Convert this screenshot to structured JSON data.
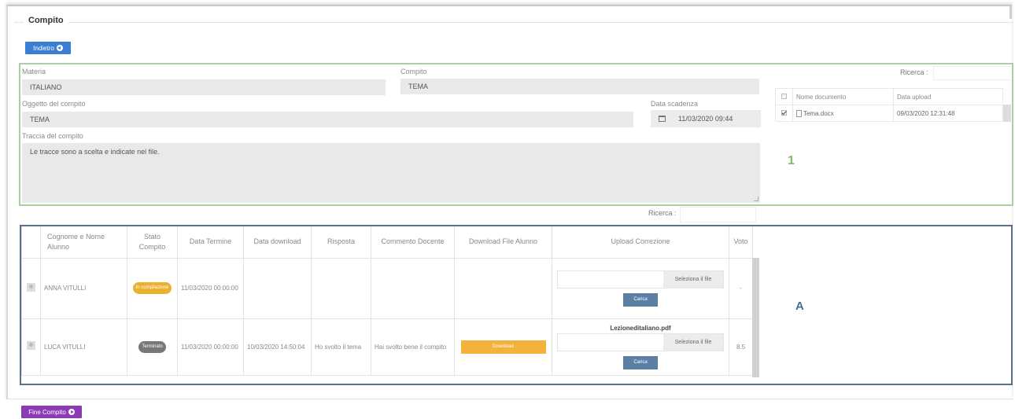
{
  "header": {
    "title": "Compito",
    "back_button": "Indietro"
  },
  "assignment": {
    "materia_label": "Materia",
    "materia_value": "ITALIANO",
    "compito_label": "Compito",
    "compito_value": "TEMA",
    "oggetto_label": "Oggetto del compito",
    "oggetto_value": "TEMA",
    "scadenza_label": "Data scadenza",
    "scadenza_value": "11/03/2020 09:44",
    "traccia_label": "Traccia del compito",
    "traccia_value": "Le tracce sono a scelta e  indicate nel file."
  },
  "documents": {
    "search_label": "Ricerca :",
    "columns": [
      "Nome documento",
      "Data upload"
    ],
    "rows": [
      {
        "name": "Tema.docx",
        "date": "09/03/2020 12:31:48"
      }
    ]
  },
  "annotation_1": "1",
  "students": {
    "search_label": "Ricerca :",
    "columns": {
      "name": "Cognome e Nome Alunno",
      "status": "Stato Compito",
      "end": "Data Termine",
      "download_date": "Data download",
      "answer": "Risposta",
      "comment": "Commento Docente",
      "download": "Download File Alunno",
      "upload": "Upload Correzione",
      "grade": "Voto"
    },
    "rows": [
      {
        "name": "ANNA VITULLI",
        "status": "In compilazione",
        "end": "11/03/2020 00:00:00",
        "download_date": "",
        "answer": "",
        "comment": "",
        "pick_label": "Seleziona il file",
        "upload_label": "Carica",
        "grade": "-"
      },
      {
        "name": "LUCA VITULLI",
        "status": "Terminato",
        "end": "11/03/2020 00:00:00",
        "download_date": "10/03/2020 14:50:04",
        "answer": "Ho svolto il tema",
        "comment": "Hai svolto bene il compito",
        "download_label": "Download",
        "uploaded_file": "Lezioneditaliano.pdf",
        "pick_label": "Seleziona il file",
        "upload_label": "Carica",
        "grade": "8.5"
      }
    ]
  },
  "annotation_A": "A",
  "footer": {
    "finish_button": "Fine Compito"
  },
  "colors": {
    "back_button": "#3b7fd4",
    "finish_button": "#8c3bb4",
    "box_1_border": "#a9d0a0",
    "box_A_border": "#58708c",
    "status_in_progress": "#e9b12e",
    "status_done": "#777777",
    "download": "#f4b23c",
    "upload": "#5c7fa6"
  }
}
